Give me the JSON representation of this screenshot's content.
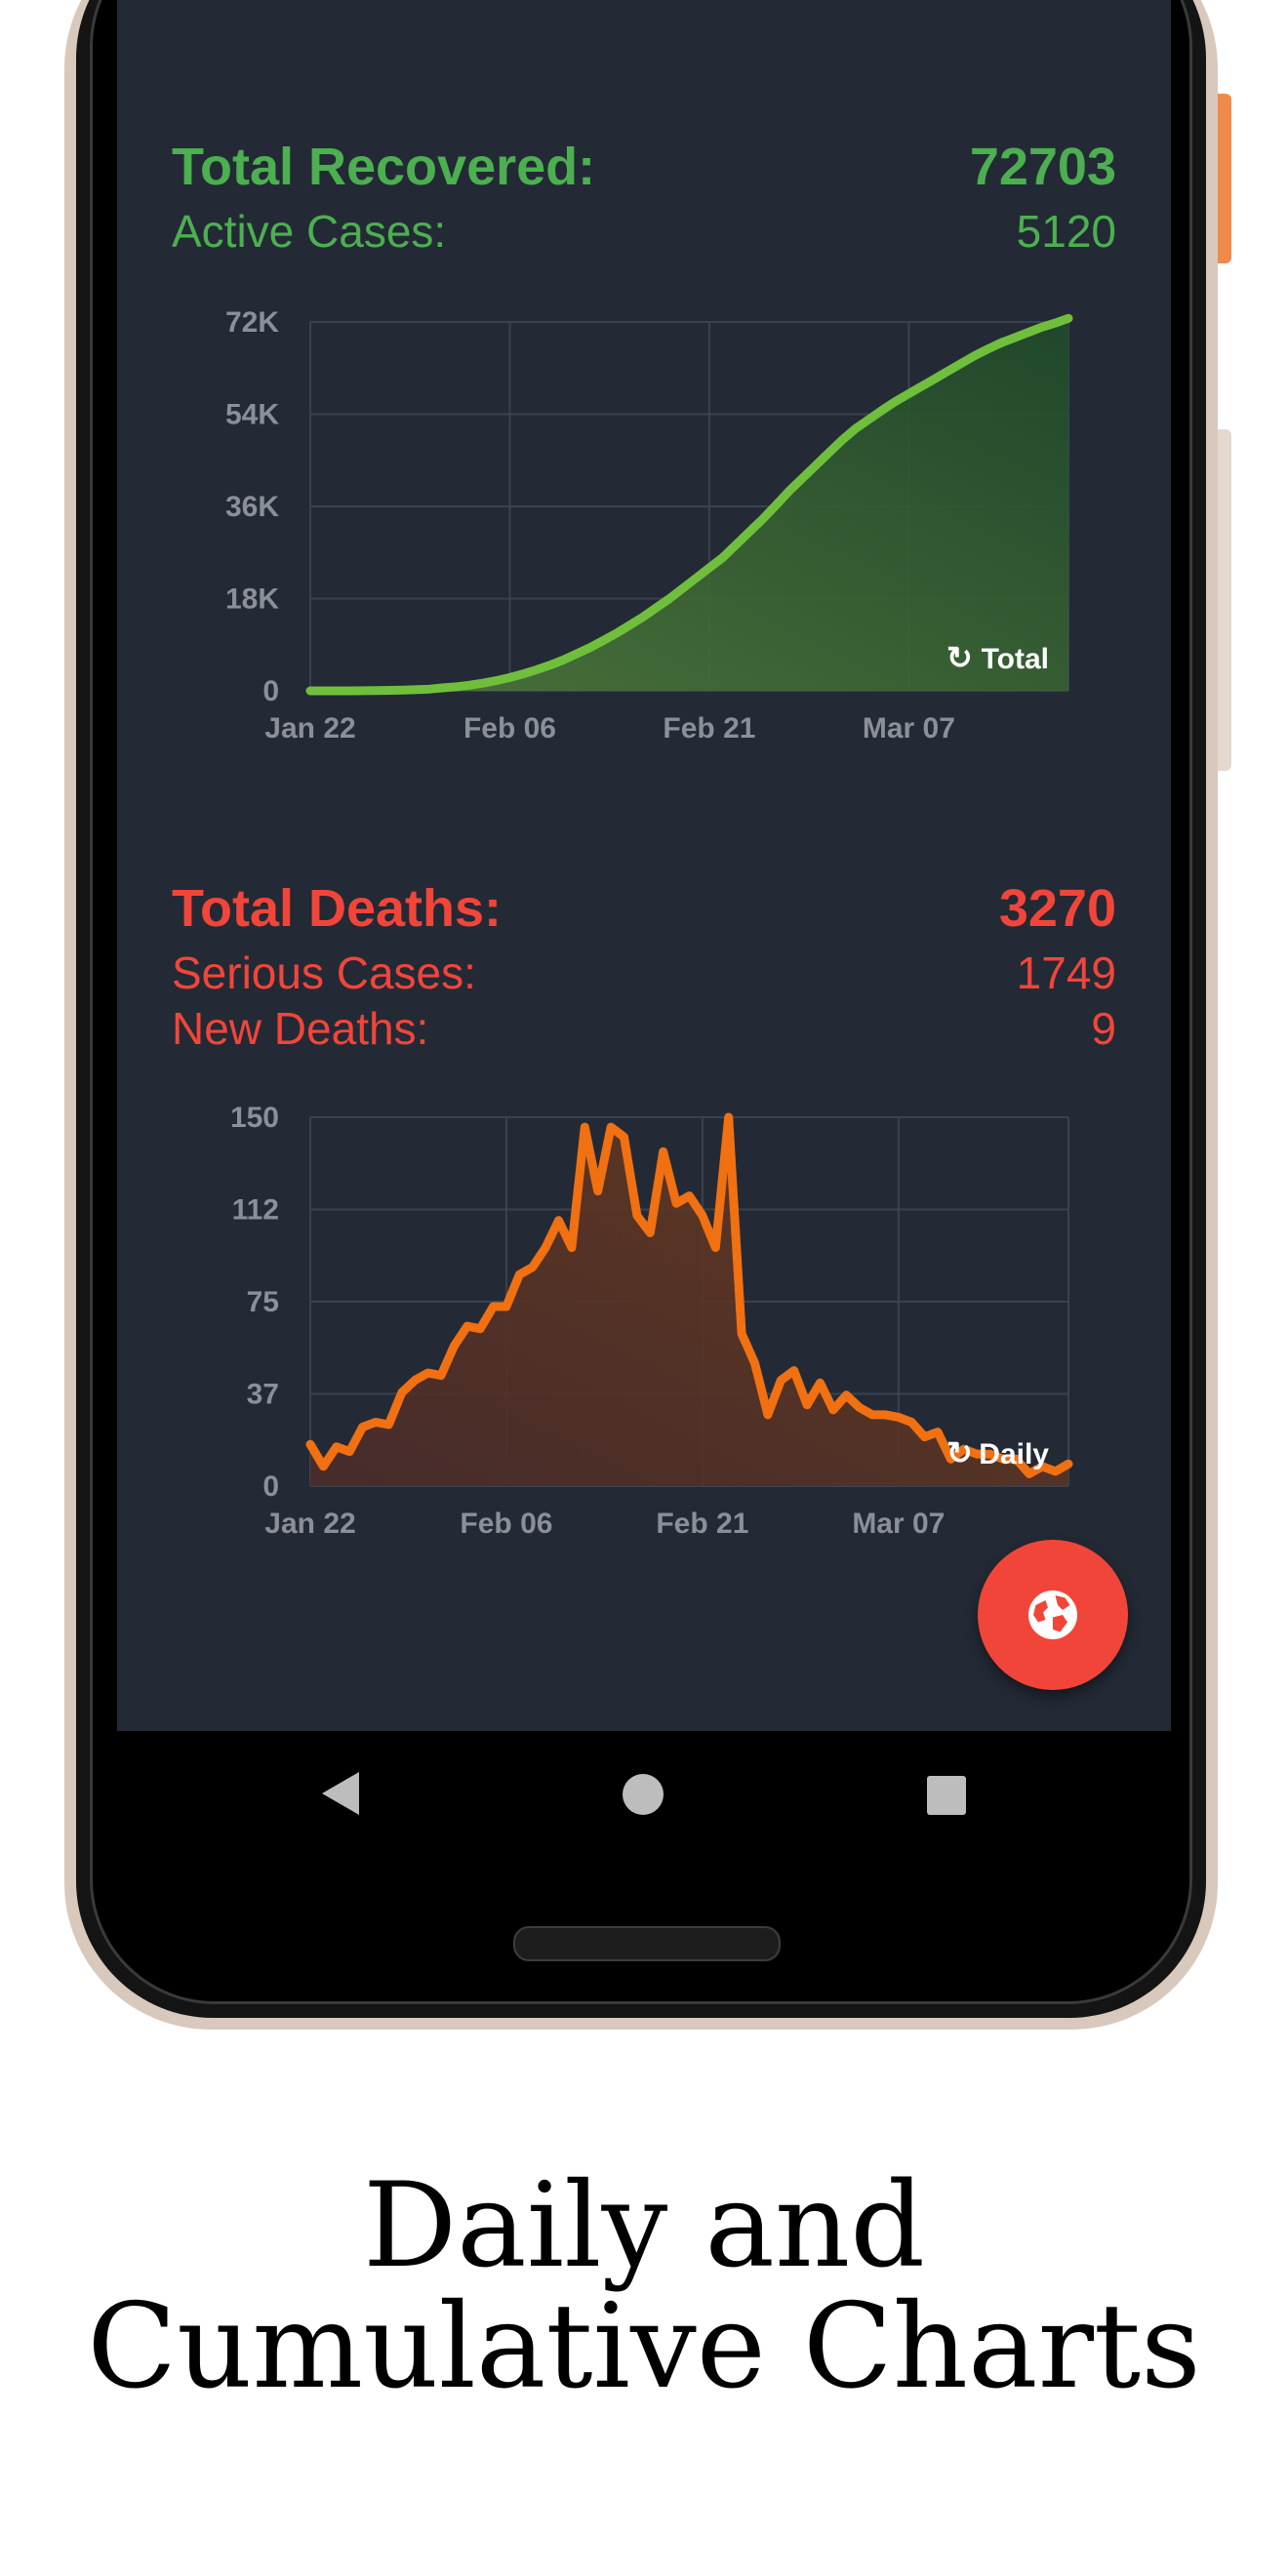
{
  "recovered": {
    "total_label": "Total Recovered:",
    "total_value": "72703",
    "active_label": "Active Cases:",
    "active_value": "5120",
    "mode_label": "Total",
    "color": "#4caf50"
  },
  "deaths": {
    "total_label": "Total Deaths:",
    "total_value": "3270",
    "serious_label": "Serious Cases:",
    "serious_value": "1749",
    "new_label": "New Deaths:",
    "new_value": "9",
    "mode_label": "Daily",
    "color": "#f2453a"
  },
  "fab_icon": "globe-icon",
  "nav": {
    "back_icon": "back-icon",
    "home_icon": "home-icon",
    "recent_icon": "recents-icon"
  },
  "caption": {
    "line1": "Daily and",
    "line2": "Cumulative Charts"
  },
  "chart_data": [
    {
      "type": "area",
      "series": [
        {
          "values": [
            0,
            0,
            0,
            0,
            10,
            50,
            100,
            150,
            250,
            350,
            600,
            800,
            1100,
            1500,
            2000,
            2600,
            3300,
            4100,
            5000,
            6000,
            7200,
            8400,
            9800,
            11200,
            12800,
            14400,
            16200,
            18000,
            20000,
            22000,
            24000,
            26000,
            28500,
            31000,
            33500,
            36200,
            39000,
            41500,
            44000,
            46500,
            49000,
            51200,
            53000,
            54800,
            56500,
            58000,
            59500,
            61000,
            62500,
            64000,
            65500,
            66800,
            68000,
            69000,
            70000,
            71000,
            71800,
            72703
          ]
        }
      ],
      "x_start": "2020-01-22",
      "x_end": "2020-03-19",
      "x_ticks": [
        "Jan 22",
        "Feb 06",
        "Feb 21",
        "Mar 07"
      ],
      "y_ticks": [
        "0",
        "18K",
        "36K",
        "54K",
        "72K"
      ],
      "ylim": [
        0,
        72000
      ],
      "line_color": "#6fbf3c",
      "grid": true
    },
    {
      "type": "area",
      "series": [
        {
          "values": [
            17,
            8,
            16,
            14,
            24,
            26,
            25,
            38,
            43,
            46,
            45,
            57,
            65,
            64,
            73,
            73,
            86,
            89,
            97,
            108,
            97,
            146,
            120,
            146,
            142,
            110,
            103,
            136,
            115,
            118,
            110,
            97,
            150,
            62,
            50,
            29,
            43,
            47,
            33,
            42,
            31,
            37,
            32,
            29,
            29,
            28,
            26,
            20,
            22,
            11,
            15,
            13,
            13,
            11,
            11,
            5,
            8,
            6,
            9
          ]
        }
      ],
      "x_start": "2020-01-22",
      "x_end": "2020-03-20",
      "x_ticks": [
        "Jan 22",
        "Feb 06",
        "Feb 21",
        "Mar 07"
      ],
      "y_ticks": [
        "0",
        "37",
        "75",
        "112",
        "150"
      ],
      "ylim": [
        0,
        150
      ],
      "line_color": "#f07012",
      "grid": true
    }
  ]
}
